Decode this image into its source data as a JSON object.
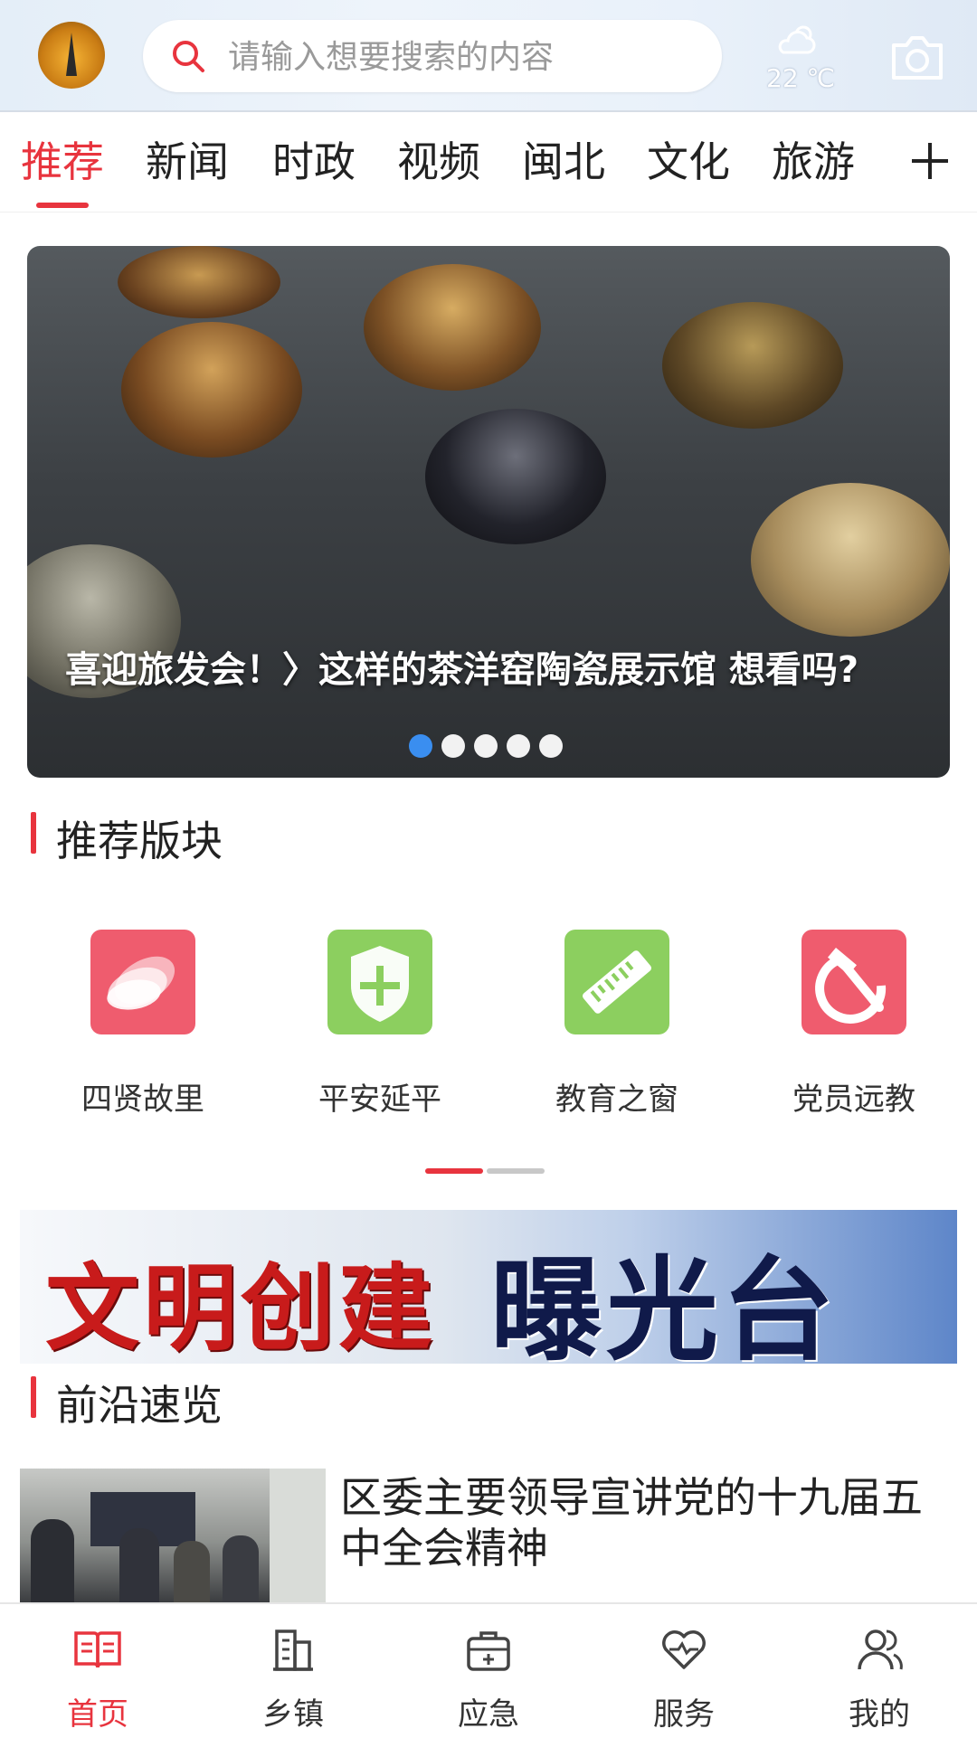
{
  "header": {
    "search_placeholder": "请输入想要搜索的内容",
    "weather": {
      "temperature": "22 ℃",
      "icon": "partly-cloudy-icon"
    }
  },
  "tabs": [
    {
      "label": "推荐",
      "active": true
    },
    {
      "label": "新闻",
      "active": false
    },
    {
      "label": "时政",
      "active": false
    },
    {
      "label": "视频",
      "active": false
    },
    {
      "label": "闽北",
      "active": false
    },
    {
      "label": "文化",
      "active": false
    },
    {
      "label": "旅游",
      "active": false
    }
  ],
  "banner": {
    "caption": "喜迎旅发会！〉这样的茶洋窑陶瓷展示馆 想看吗?",
    "slide_count": 5,
    "active_slide": 1
  },
  "recommended": {
    "title": "推荐版块",
    "items": [
      {
        "label": "四贤故里",
        "icon": "petals-icon",
        "color": "#ef5c6e"
      },
      {
        "label": "平安延平",
        "icon": "shield-icon",
        "color": "#8ccf5f"
      },
      {
        "label": "教育之窗",
        "icon": "ruler-icon",
        "color": "#8ccf5f"
      },
      {
        "label": "党员远教",
        "icon": "hammer-sickle-icon",
        "color": "#ef5c6e"
      }
    ]
  },
  "promo": {
    "text_red": "文明创建",
    "text_blue": "曝光台"
  },
  "frontier": {
    "title": "前沿速览",
    "news": [
      {
        "title": "区委主要领导宣讲党的十九届五中全会精神"
      }
    ]
  },
  "bottom_nav": [
    {
      "label": "首页",
      "icon": "book-icon",
      "active": true
    },
    {
      "label": "乡镇",
      "icon": "building-icon",
      "active": false
    },
    {
      "label": "应急",
      "icon": "first-aid-kit-icon",
      "active": false
    },
    {
      "label": "服务",
      "icon": "heart-icon",
      "active": false
    },
    {
      "label": "我的",
      "icon": "user-icon",
      "active": false
    }
  ],
  "colors": {
    "accent": "#e8343e",
    "dot_active": "#3a8ef0"
  }
}
